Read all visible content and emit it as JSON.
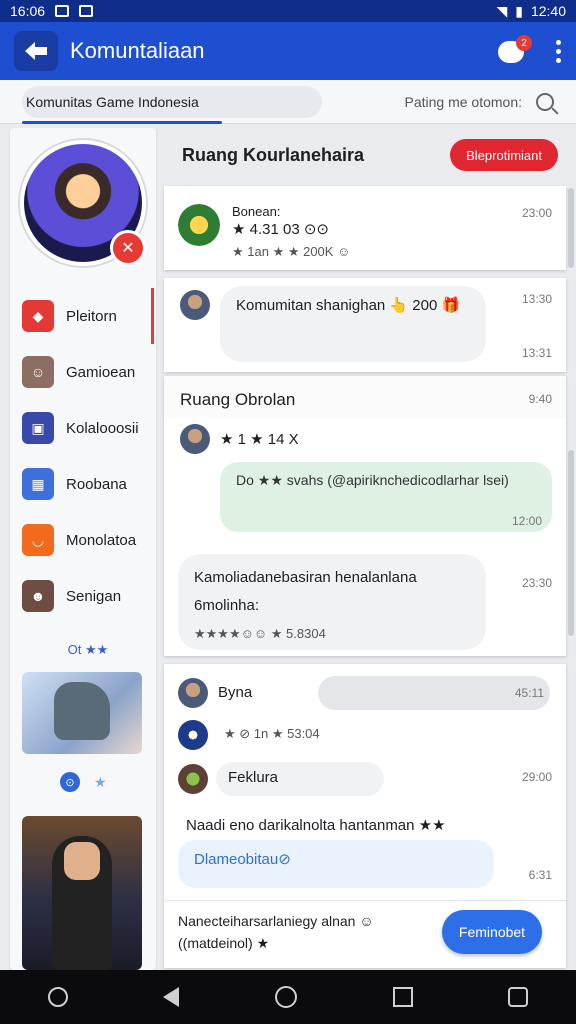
{
  "status_bar": {
    "time_left": "16:06",
    "time_right": "12:40"
  },
  "app_bar": {
    "title": "Komuntaliaan",
    "badge_count": "2"
  },
  "search": {
    "tab_label": "Komunitas Game Indonesia",
    "hint": "Pating me otomon:"
  },
  "sidebar": {
    "items": [
      {
        "label": "Pleitorn",
        "icon": "diamond-icon",
        "color": "#e53935"
      },
      {
        "label": "Gamioean",
        "icon": "game-avatar-icon",
        "color": "#8d6e63"
      },
      {
        "label": "Kolalooosii",
        "icon": "collection-icon",
        "color": "#3949ab"
      },
      {
        "label": "Roobana",
        "icon": "grid-icon",
        "color": "#3f6fd8"
      },
      {
        "label": "Monolatoa",
        "icon": "cup-icon",
        "color": "#f26a1b"
      },
      {
        "label": "Senigan",
        "icon": "character-icon",
        "color": "#6d4c41"
      }
    ],
    "more_label": "Ot ★★",
    "dot_label": "⊙",
    "star": "★"
  },
  "main": {
    "room_title": "Ruang Kourlanehaira",
    "room_button": "Bleprotimiant",
    "card1": {
      "name": "Bonean:",
      "line1": "★ 4.31 03 ⊙⊙",
      "line2": "★ 1an ★ ★ 200K ☺",
      "time": "23:00"
    },
    "card2": {
      "text": "Komumitan shanighan 👆 200 🎁",
      "time_top": "13:30",
      "time_bottom": "13:31"
    },
    "section_title": "Ruang Obrolan",
    "section_time": "9:40",
    "msg1": {
      "line": "★ 1 ★ 14 X"
    },
    "msg1_bubble": {
      "text": "Do ★★ svahs (@apiriknchedicodlarhar lsei)",
      "time": "12:00"
    },
    "msg2": {
      "text": "Kamoliadanebasiran henalanlana 6molinha:",
      "reactions": "★★★★☺☺ ★ 5.8304",
      "time": "23:30"
    },
    "bottom_card": {
      "user": "Byna",
      "user_time": "45:11",
      "row2": "★ ⊘ 1n ★ 53:04",
      "feature": "Feklura",
      "feature_time": "29:00",
      "msg": "Naadi eno darikalnolta hantanman ★★",
      "link": "Dlameobitau⊘",
      "link_time": "6:31",
      "footer": "Nanecteiharsarlaniegy alnan ☺ ((matdeinol) ★",
      "cta": "Feminobet"
    }
  }
}
